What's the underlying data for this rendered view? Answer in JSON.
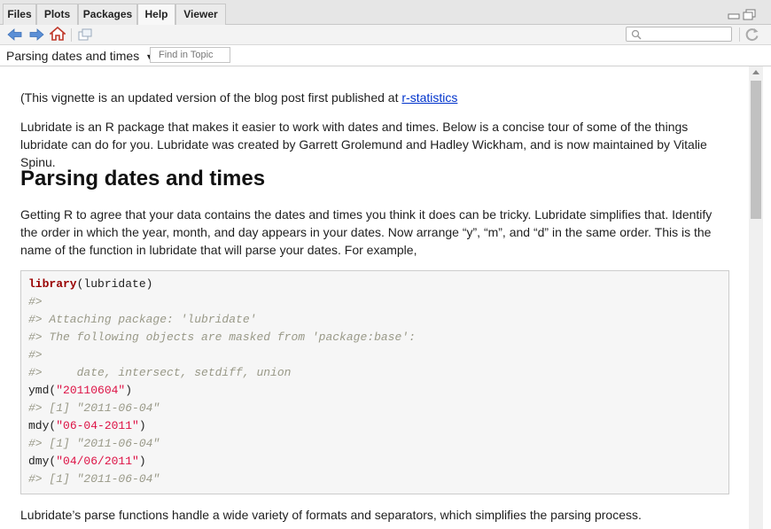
{
  "tabs": [
    {
      "label": "Files"
    },
    {
      "label": "Plots"
    },
    {
      "label": "Packages"
    },
    {
      "label": "Help"
    },
    {
      "label": "Viewer"
    }
  ],
  "active_tab": "Help",
  "topic": {
    "title": "Parsing dates and times",
    "find_placeholder": "Find in Topic"
  },
  "doc": {
    "intro_prefix": "(This vignette is an updated version of the blog post first published at ",
    "intro_link": "r-statistics ",
    "para1": "Lubridate is an R package that makes it easier to work with dates and times. Below is a concise tour of some of the things lubridate can do for you. Lubridate was created by Garrett Grolemund and Hadley Wickham, and is now maintained by Vitalie Spinu.",
    "heading": "Parsing dates and times",
    "para2": "Getting R to agree that your data contains the dates and times you think it does can be tricky. Lubridate simplifies that. Identify the order in which the year, month, and day appears in your dates. Now arrange “y”, “m”, and “d” in the same order. This is the name of the function in lubridate that will parse your dates. For example,",
    "para3": "Lubridate’s parse functions handle a wide variety of formats and separators, which simplifies the parsing process."
  },
  "code": {
    "l1_kw": "library",
    "l1_rest": "(lubridate)",
    "l2": "#>",
    "l3": "#> Attaching package: 'lubridate'",
    "l4": "#> The following objects are masked from 'package:base':",
    "l5": "#>",
    "l6": "#>     date, intersect, setdiff, union",
    "l7_fn": "ymd(",
    "l7_str": "\"20110604\"",
    "l7_end": ")",
    "l8": "#> [1] \"2011-06-04\"",
    "l9_fn": "mdy(",
    "l9_str": "\"06-04-2011\"",
    "l9_end": ")",
    "l10": "#> [1] \"2011-06-04\"",
    "l11_fn": "dmy(",
    "l11_str": "\"04/06/2011\"",
    "l11_end": ")",
    "l12": "#> [1] \"2011-06-04\""
  },
  "colors": {
    "accent": "#0033cc",
    "keyword": "#990000",
    "string": "#dd1144",
    "comment": "#999988"
  },
  "icons": [
    "back-arrow-icon",
    "forward-arrow-icon",
    "home-icon",
    "popout-icon",
    "search-icon",
    "refresh-icon",
    "minimize-icon",
    "maximize-icon",
    "dropdown-caret-icon"
  ]
}
